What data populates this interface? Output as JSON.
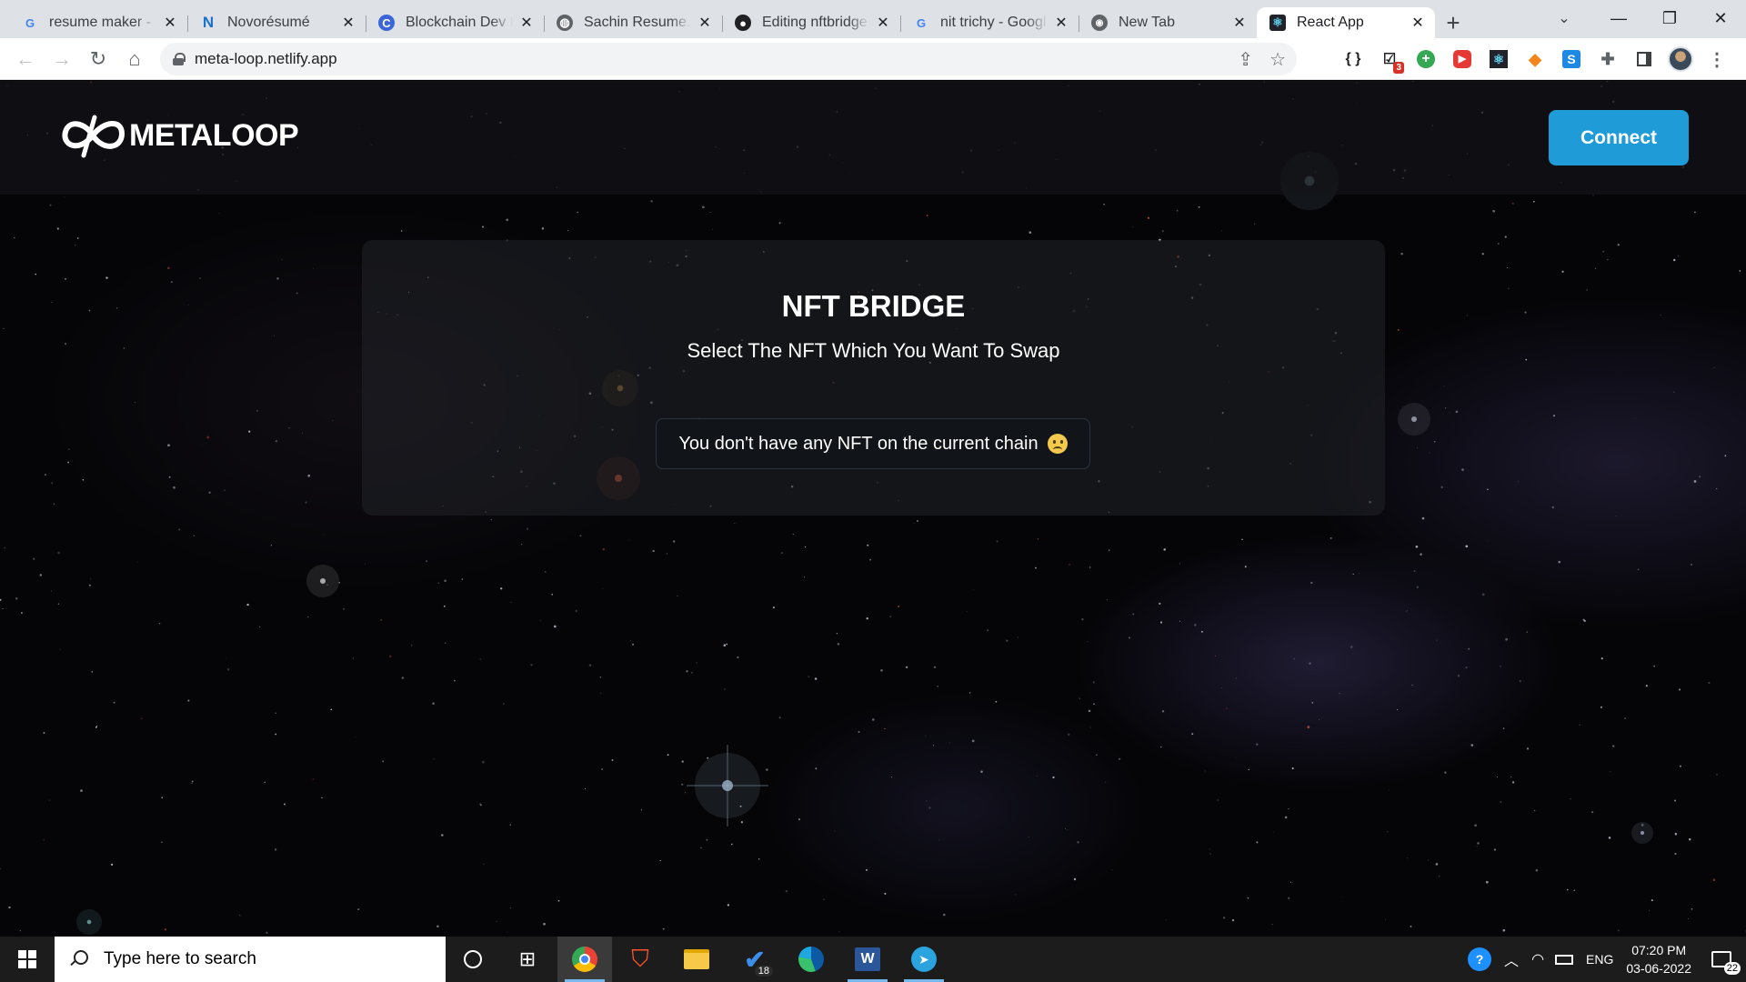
{
  "browser": {
    "tabs": [
      {
        "title": "resume maker - G",
        "icon": "google-icon",
        "active": false
      },
      {
        "title": "Novorésumé",
        "icon": "novoresume-icon",
        "active": false
      },
      {
        "title": "Blockchain Dev R",
        "icon": "c-logo-icon",
        "active": false
      },
      {
        "title": "Sachin Resume.pc",
        "icon": "globe-icon",
        "active": false
      },
      {
        "title": "Editing nftbridge",
        "icon": "github-icon",
        "active": false
      },
      {
        "title": "nit trichy - Googl",
        "icon": "google-icon",
        "active": false
      },
      {
        "title": "New Tab",
        "icon": "chrome-icon",
        "active": false
      },
      {
        "title": "React App",
        "icon": "react-icon",
        "active": true
      }
    ],
    "url": "meta-loop.netlify.app",
    "extension_badge": "3"
  },
  "site": {
    "brand": "METALOOP",
    "connect_label": "Connect"
  },
  "bridge": {
    "title": "NFT BRIDGE",
    "subtitle": "Select The NFT Which You Want To Swap",
    "empty_message": "You don't have any NFT on the current chain"
  },
  "taskbar": {
    "search_placeholder": "Type here to search",
    "todo_badge": "18",
    "language": "ENG",
    "time": "07:20 PM",
    "date": "03-06-2022",
    "notification_count": "22"
  },
  "colors": {
    "accent": "#1f9bd7",
    "page_bg": "#050508"
  }
}
